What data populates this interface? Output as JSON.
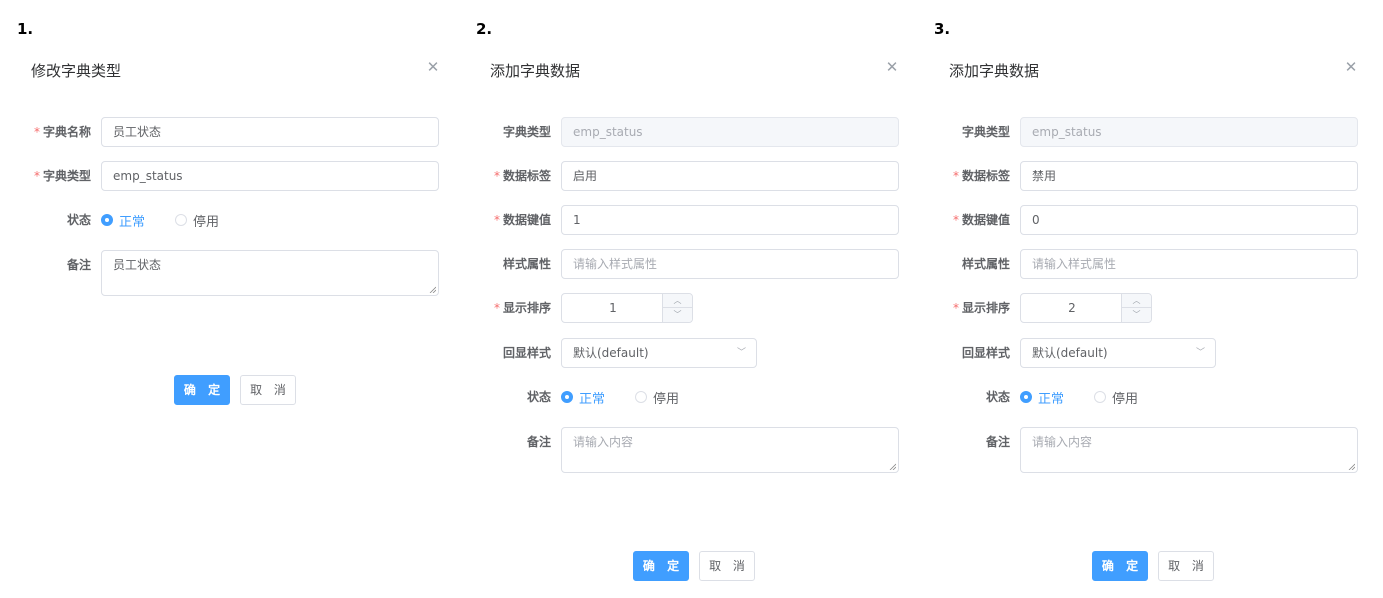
{
  "panels": [
    {
      "step": "1.",
      "title": "修改字典类型",
      "fields": {
        "dict_name": {
          "label": "字典名称",
          "value": "员工状态"
        },
        "dict_type": {
          "label": "字典类型",
          "value": "emp_status"
        },
        "status": {
          "label": "状态",
          "options": [
            "正常",
            "停用"
          ],
          "selected": "正常"
        },
        "remark": {
          "label": "备注",
          "value": "员工状态"
        }
      },
      "buttons": {
        "confirm": "确 定",
        "cancel": "取 消"
      }
    },
    {
      "step": "2.",
      "title": "添加字典数据",
      "fields": {
        "dict_type": {
          "label": "字典类型",
          "value": "emp_status"
        },
        "data_label": {
          "label": "数据标签",
          "value": "启用"
        },
        "data_value": {
          "label": "数据键值",
          "value": "1"
        },
        "css_class": {
          "label": "样式属性",
          "placeholder": "请输入样式属性"
        },
        "sort": {
          "label": "显示排序",
          "value": "1"
        },
        "list_class": {
          "label": "回显样式",
          "value": "默认(default)"
        },
        "status": {
          "label": "状态",
          "options": [
            "正常",
            "停用"
          ],
          "selected": "正常"
        },
        "remark": {
          "label": "备注",
          "placeholder": "请输入内容"
        }
      },
      "buttons": {
        "confirm": "确 定",
        "cancel": "取 消"
      }
    },
    {
      "step": "3.",
      "title": "添加字典数据",
      "fields": {
        "dict_type": {
          "label": "字典类型",
          "value": "emp_status"
        },
        "data_label": {
          "label": "数据标签",
          "value": "禁用"
        },
        "data_value": {
          "label": "数据键值",
          "value": "0"
        },
        "css_class": {
          "label": "样式属性",
          "placeholder": "请输入样式属性"
        },
        "sort": {
          "label": "显示排序",
          "value": "2"
        },
        "list_class": {
          "label": "回显样式",
          "value": "默认(default)"
        },
        "status": {
          "label": "状态",
          "options": [
            "正常",
            "停用"
          ],
          "selected": "正常"
        },
        "remark": {
          "label": "备注",
          "placeholder": "请输入内容"
        }
      },
      "buttons": {
        "confirm": "确 定",
        "cancel": "取 消"
      }
    }
  ],
  "icons": {
    "close": "close-icon",
    "stepper_up": "chevron-up-icon",
    "stepper_down": "chevron-down-icon",
    "select": "chevron-down-icon"
  },
  "colors": {
    "primary": "#409eff",
    "required": "#f56c6c",
    "border": "#dcdfe6",
    "disabled_bg": "#f5f7fa"
  }
}
